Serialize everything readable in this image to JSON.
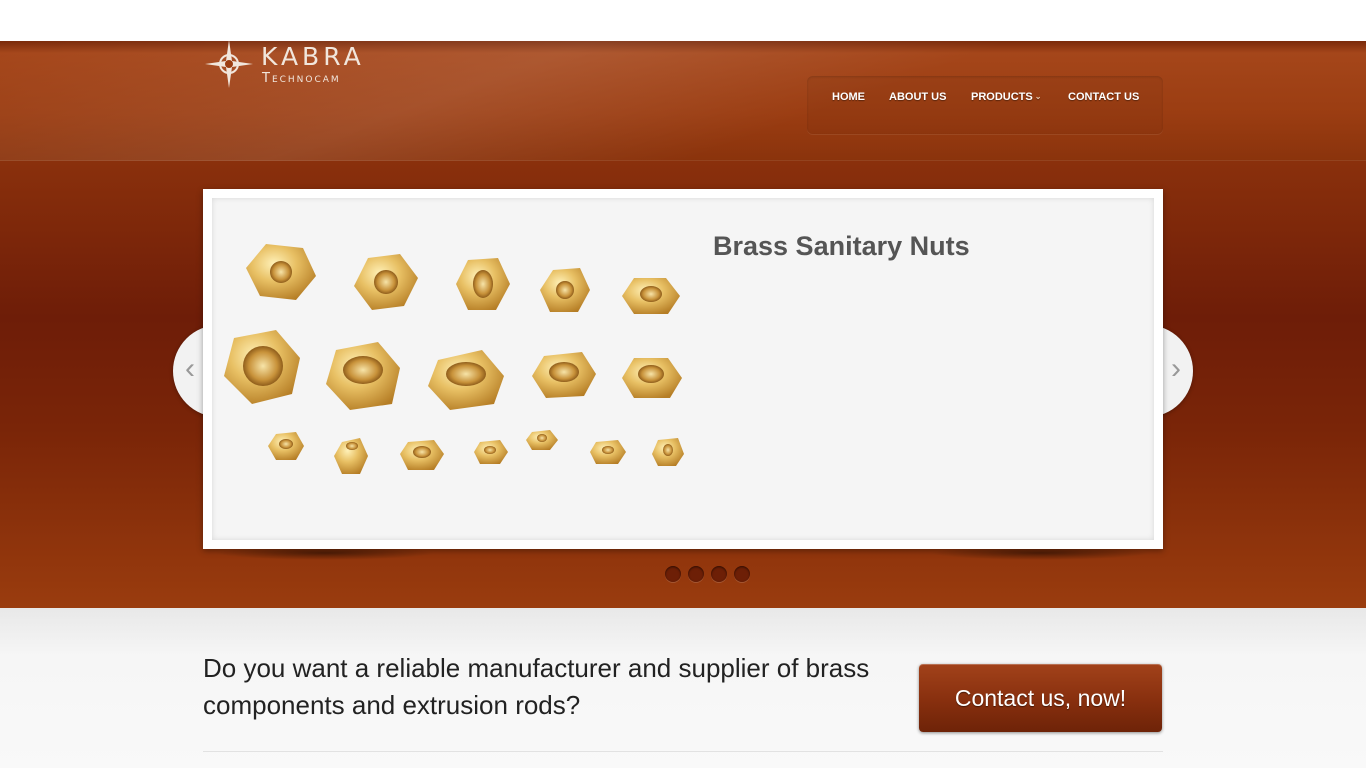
{
  "brand": {
    "name": "KABRA",
    "tagline": "Technocam"
  },
  "nav": {
    "items": [
      {
        "label": "HOME"
      },
      {
        "label": "ABOUT US"
      },
      {
        "label": "PRODUCTS"
      },
      {
        "label": "CONTACT US"
      }
    ]
  },
  "slider": {
    "title": "Brass Sanitary Nuts",
    "prev_label": "‹",
    "next_label": "›",
    "image_icon": "brass-nuts-image",
    "slide_count": 4,
    "active_index": 0
  },
  "cta": {
    "text": "Do you want a reliable manufacturer and supplier of brass components and extrusion rods?",
    "button_label": "Contact us, now!"
  },
  "colors": {
    "brand": "#9b3d12",
    "hero_dark": "#6e1d08",
    "button": "#872f0e",
    "title_gray": "#555555"
  }
}
